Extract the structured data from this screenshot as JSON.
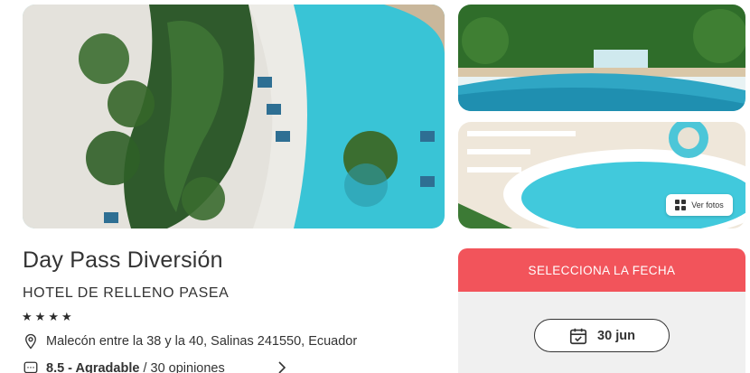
{
  "gallery": {
    "view_photos_label": "Ver fotos",
    "icons": {
      "view_photos": "grid-icon"
    }
  },
  "listing": {
    "title": "Day Pass Diversión",
    "hotel_name": "HOTEL DE RELLENO PASEA",
    "stars": 4,
    "star_glyph": "★",
    "address": "Malecón entre la 38 y la 40, Salinas 241550, Ecuador",
    "rating_score": "8.5 - Agradable",
    "rating_reviews": "/ 30 opiniones",
    "icons": {
      "address": "location-pin-icon",
      "rating": "chat-bubble-icon",
      "more": "chevron-right-icon"
    }
  },
  "booking": {
    "header_label": "SELECCIONA LA FECHA",
    "date_value": "30 jun",
    "header_color": "#f2545b",
    "icons": {
      "date": "calendar-icon"
    }
  }
}
